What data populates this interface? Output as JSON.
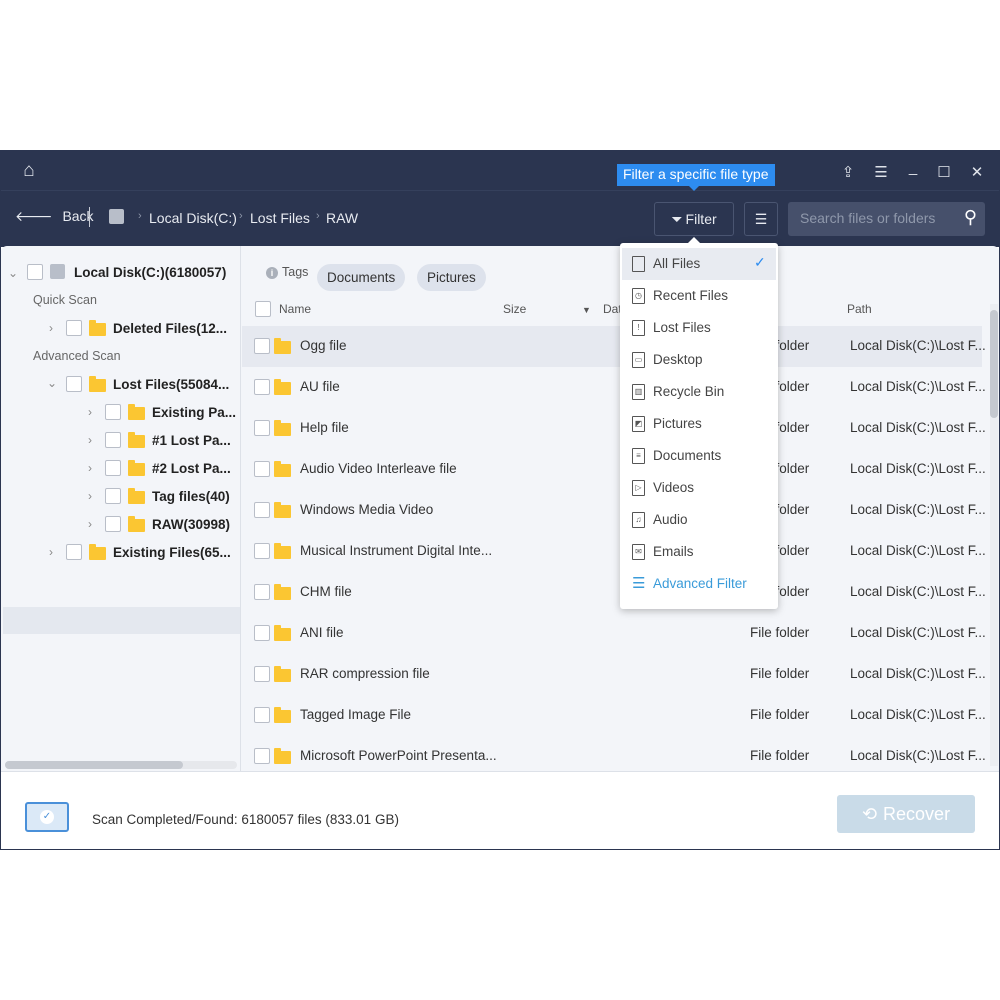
{
  "titlebar": {
    "tooltip": "Filter a specific file type"
  },
  "toolbar": {
    "back": "Back",
    "breadcrumb": [
      "Local Disk(C:)",
      "Lost Files",
      "RAW"
    ],
    "filter": "Filter",
    "search_placeholder": "Search files or folders"
  },
  "sidebar": {
    "root": "Local Disk(C:)(6180057)",
    "quick_scan": "Quick Scan",
    "deleted": "Deleted Files(12...",
    "advanced_scan": "Advanced Scan",
    "lost": "Lost Files(55084...",
    "children": [
      "Existing Pa...",
      "#1 Lost Pa...",
      "#2 Lost Pa...",
      "Tag files(40)",
      "RAW(30998)"
    ],
    "existing": "Existing Files(65..."
  },
  "tags": {
    "label": "Tags",
    "items": [
      "Documents",
      "Pictures"
    ]
  },
  "columns": {
    "name": "Name",
    "size": "Size",
    "date": "Dat",
    "path": "Path"
  },
  "rows": [
    {
      "name": "Ogg file",
      "type": "File folder",
      "path": "Local Disk(C:)\\Lost F..."
    },
    {
      "name": "AU file",
      "type": "File folder",
      "path": "Local Disk(C:)\\Lost F..."
    },
    {
      "name": "Help file",
      "type": "File folder",
      "path": "Local Disk(C:)\\Lost F..."
    },
    {
      "name": "Audio Video Interleave file",
      "type": "File folder",
      "path": "Local Disk(C:)\\Lost F..."
    },
    {
      "name": "Windows Media Video",
      "type": "File folder",
      "path": "Local Disk(C:)\\Lost F..."
    },
    {
      "name": "Musical Instrument Digital Inte...",
      "type": "File folder",
      "path": "Local Disk(C:)\\Lost F..."
    },
    {
      "name": "CHM file",
      "type": "File folder",
      "path": "Local Disk(C:)\\Lost F..."
    },
    {
      "name": "ANI file",
      "type": "File folder",
      "path": "Local Disk(C:)\\Lost F..."
    },
    {
      "name": "RAR compression file",
      "type": "File folder",
      "path": "Local Disk(C:)\\Lost F..."
    },
    {
      "name": "Tagged Image File",
      "type": "File folder",
      "path": "Local Disk(C:)\\Lost F..."
    },
    {
      "name": "Microsoft PowerPoint Presenta...",
      "type": "File folder",
      "path": "Local Disk(C:)\\Lost F..."
    }
  ],
  "filter_menu": {
    "items": [
      "All Files",
      "Recent Files",
      "Lost Files",
      "Desktop",
      "Recycle Bin",
      "Pictures",
      "Documents",
      "Videos",
      "Audio",
      "Emails"
    ],
    "selected": "All Files",
    "advanced": "Advanced Filter",
    "check": "✓"
  },
  "footer": {
    "status": "Scan Completed/Found: 6180057 files (833.01 GB)",
    "recover": "Recover"
  },
  "colors": {
    "titlebar": "#2b3550",
    "accent": "#2d8cf0",
    "folder": "#fbc632",
    "recover_disabled": "#c9dbe8"
  }
}
